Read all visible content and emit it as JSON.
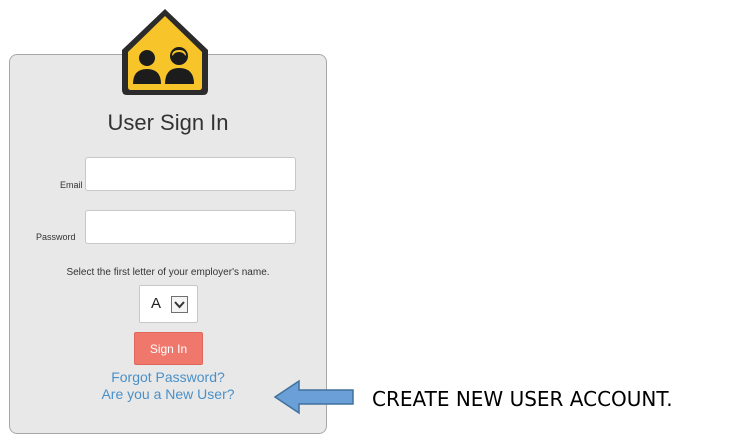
{
  "signin": {
    "title": "User Sign In",
    "email_label": "Email",
    "email_value": "",
    "password_label": "Password",
    "password_value": "",
    "employer_prompt": "Select the first letter of your employer's name.",
    "employer_letter": "A",
    "signin_label": "Sign In",
    "forgot_label": "Forgot Password?",
    "new_user_label": "Are you a New User?"
  },
  "annotation": {
    "text": "CREATE NEW USER ACCOUNT."
  },
  "colors": {
    "card_background": "#e8e8e8",
    "button": "#f0776c",
    "link": "#4a90c8",
    "logo_yellow": "#f7c52a",
    "arrow_blue": "#6a9fd8"
  }
}
